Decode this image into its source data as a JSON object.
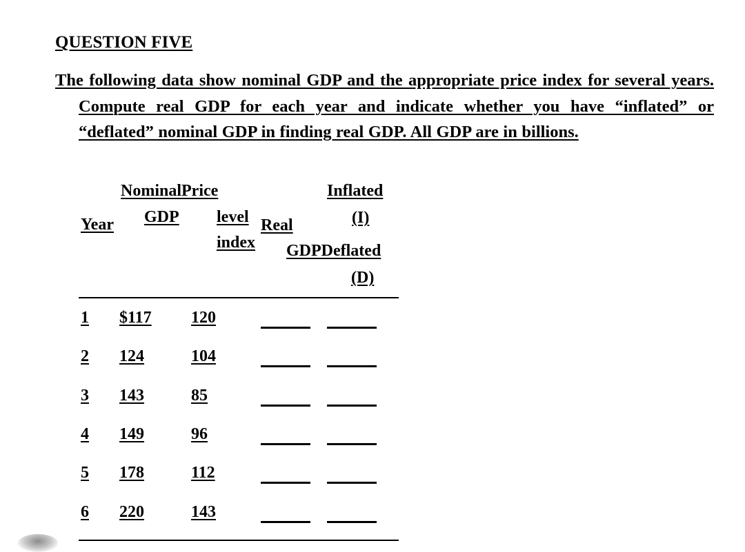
{
  "document": {
    "heading": "QUESTION FIVE",
    "body": "The following data show nominal GDP and the appropriate price index for several years.  Compute real GDP for each year and indicate whether you have “inflated” or “deflated” nominal GDP in finding real GDP.  All GDP are in billions."
  },
  "table": {
    "headers": {
      "nominal_price": "NominalPrice",
      "year": "Year",
      "gdp": "GDP",
      "level": "level",
      "index": "index",
      "real": "Real",
      "gdp_deflated": "GDPDeflated",
      "inflated": "Inflated",
      "i_code": "(I)",
      "d_code": "(D)"
    },
    "columns": [
      "Year",
      "Nominal GDP",
      "Price level index",
      "Real GDP",
      "Inflated (I) Deflated (D)"
    ],
    "rows": [
      {
        "year": "1",
        "nominal_gdp": "$117",
        "price_index": "120",
        "real_gdp": "",
        "inflated_deflated": ""
      },
      {
        "year": "2",
        "nominal_gdp": "124",
        "price_index": "104",
        "real_gdp": "",
        "inflated_deflated": ""
      },
      {
        "year": "3",
        "nominal_gdp": "143",
        "price_index": "85",
        "real_gdp": "",
        "inflated_deflated": ""
      },
      {
        "year": "4",
        "nominal_gdp": "149",
        "price_index": "96",
        "real_gdp": "",
        "inflated_deflated": ""
      },
      {
        "year": "5",
        "nominal_gdp": "178",
        "price_index": "112",
        "real_gdp": "",
        "inflated_deflated": ""
      },
      {
        "year": "6",
        "nominal_gdp": "220",
        "price_index": "143",
        "real_gdp": "",
        "inflated_deflated": ""
      }
    ]
  }
}
